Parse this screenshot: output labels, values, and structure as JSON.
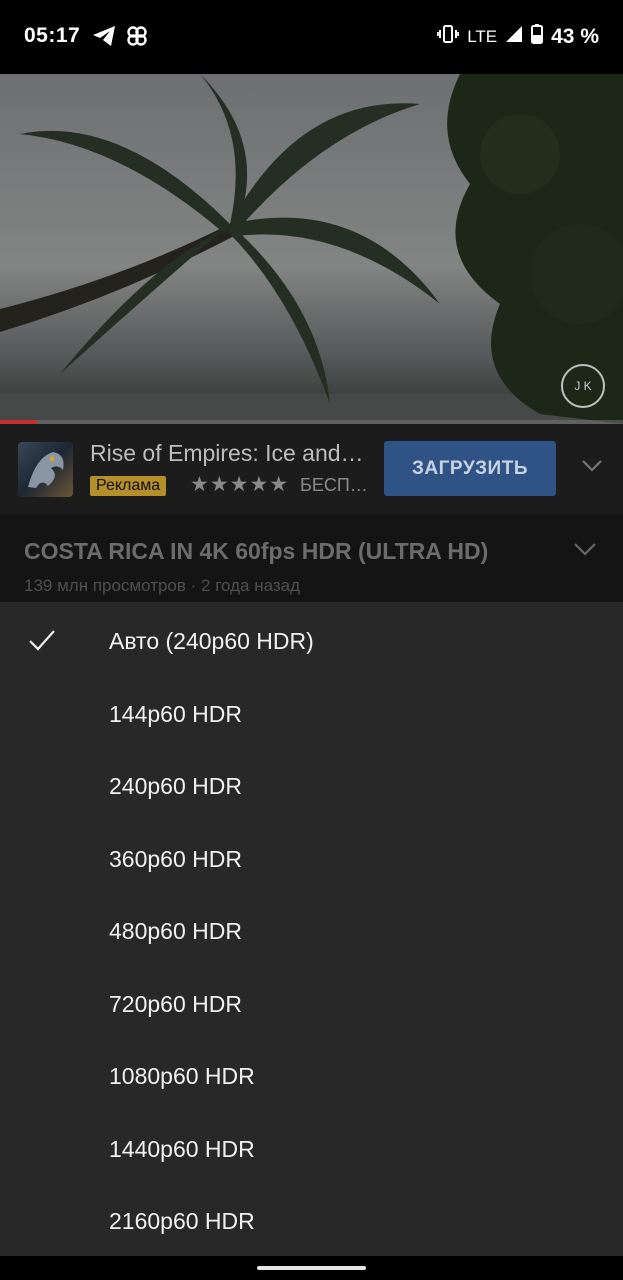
{
  "status_bar": {
    "time": "05:17",
    "network": "LTE",
    "battery": "43 %",
    "icons": [
      "telegram-icon",
      "pinwheel-icon",
      "vibrate-icon",
      "signal-icon",
      "battery-icon"
    ]
  },
  "video": {
    "watermark": "J K",
    "progress": 0.06
  },
  "ad": {
    "title": "Rise of Empires: Ice and…",
    "badge": "Реклама",
    "rating": "★★★★★",
    "price": "БЕСП…",
    "button": "ЗАГРУЗИТЬ"
  },
  "video_info": {
    "title": "COSTA RICA IN 4K 60fps HDR (ULTRA HD)",
    "meta": "139 млн просмотров · 2 года назад"
  },
  "quality_menu": {
    "items": [
      {
        "label": "Авто (240p60 HDR)",
        "selected": true
      },
      {
        "label": "144p60 HDR",
        "selected": false
      },
      {
        "label": "240p60 HDR",
        "selected": false
      },
      {
        "label": "360p60 HDR",
        "selected": false
      },
      {
        "label": "480p60 HDR",
        "selected": false
      },
      {
        "label": "720p60 HDR",
        "selected": false
      },
      {
        "label": "1080p60 HDR",
        "selected": false
      },
      {
        "label": "1440p60 HDR",
        "selected": false
      },
      {
        "label": "2160p60 HDR",
        "selected": false
      }
    ]
  },
  "colors": {
    "sheet_bg": "#282828",
    "accent_button": "#2f5384",
    "progress": "#c4302b",
    "ad_badge": "#b58f2a"
  }
}
